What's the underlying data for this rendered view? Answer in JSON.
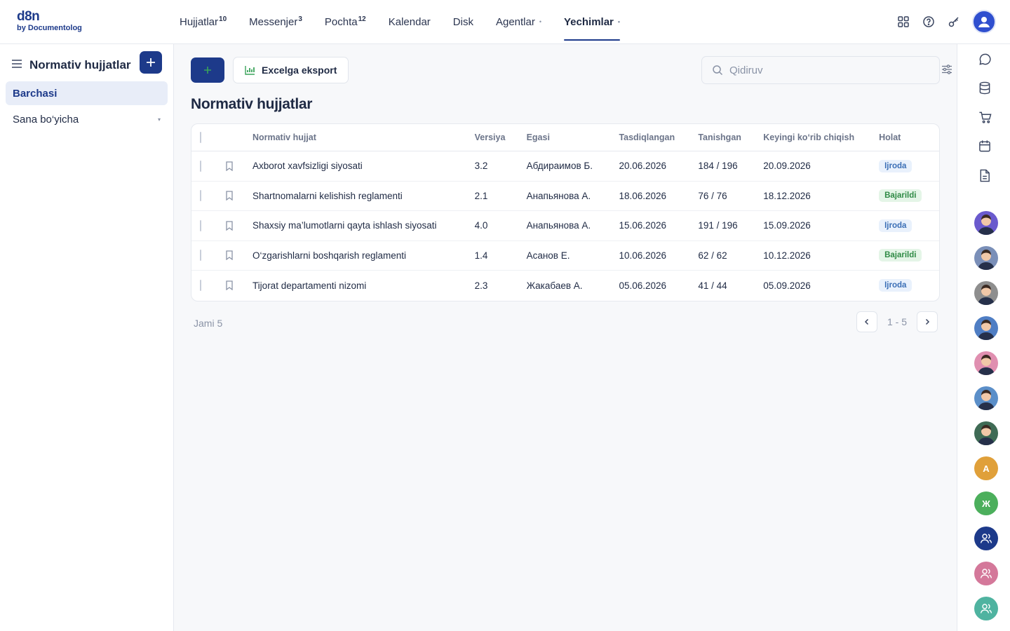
{
  "brand": {
    "line1": "d8n",
    "line2": "by Documentolog"
  },
  "nav": [
    {
      "label": "Hujjatlar",
      "badge": "10"
    },
    {
      "label": "Messenjer",
      "badge": "3"
    },
    {
      "label": "Pochta",
      "badge": "12"
    },
    {
      "label": "Kalendar"
    },
    {
      "label": "Disk"
    },
    {
      "label": "Agentlar",
      "dot": "•"
    },
    {
      "label": "Yechimlar",
      "dot": "•",
      "active": true
    }
  ],
  "top_icons": [
    "apps-grid-icon",
    "help-circle-icon",
    "key-icon",
    "user-avatar-icon"
  ],
  "sidebar": {
    "title": "Normativ hujjatlar",
    "items": [
      {
        "label": "Barchasi",
        "active": true
      },
      {
        "label": "Sana bo‘yicha",
        "caret": "▾"
      }
    ]
  },
  "toolbar": {
    "export_label": "Excelga eksport",
    "search_placeholder": "Qidiruv"
  },
  "page_title": "Normativ hujjatlar",
  "table": {
    "columns": [
      "Normativ hujjat",
      "Versiya",
      "Egasi",
      "Tasdiqlangan",
      "Tanishgan",
      "Keyingi ko‘rib chiqish",
      "Holat"
    ],
    "rows": [
      {
        "name": "Axborot xavfsizligi siyosati",
        "version": "3.2",
        "owner": "Абдираимов Б.",
        "approved": "20.06.2026",
        "acknowledged": "184 / 196",
        "next_review": "20.09.2026",
        "status": "Ijroda",
        "status_color": "blue"
      },
      {
        "name": "Shartnomalarni kelishish reglamenti",
        "version": "2.1",
        "owner": "Анапьянова А.",
        "approved": "18.06.2026",
        "acknowledged": "76 / 76",
        "next_review": "18.12.2026",
        "status": "Bajarildi",
        "status_color": "green"
      },
      {
        "name": "Shaxsiy ma’lumotlarni qayta ishlash siyosati",
        "version": "4.0",
        "owner": "Анапьянова А.",
        "approved": "15.06.2026",
        "acknowledged": "191 / 196",
        "next_review": "15.09.2026",
        "status": "Ijroda",
        "status_color": "blue"
      },
      {
        "name": "O‘zgarishlarni boshqarish reglamenti",
        "version": "1.4",
        "owner": "Асанов Е.",
        "approved": "10.06.2026",
        "acknowledged": "62 / 62",
        "next_review": "10.12.2026",
        "status": "Bajarildi",
        "status_color": "green"
      },
      {
        "name": "Tijorat departamenti nizomi",
        "version": "2.3",
        "owner": "Жакабаев А.",
        "approved": "05.06.2026",
        "acknowledged": "41 / 44",
        "next_review": "05.09.2026",
        "status": "Ijroda",
        "status_color": "blue"
      }
    ]
  },
  "footer": {
    "total": "Jami 5",
    "range": "1 - 5"
  },
  "rail": {
    "icons": [
      "chat-icon",
      "database-icon",
      "cart-icon",
      "calendar-icon",
      "document-icon"
    ],
    "avatars": [
      {
        "kind": "photo",
        "color": "#6a5acd"
      },
      {
        "kind": "photo",
        "color": "#7a8fb8"
      },
      {
        "kind": "photo",
        "color": "#8e8e8e"
      },
      {
        "kind": "photo",
        "color": "#4f7ec4"
      },
      {
        "kind": "photo",
        "color": "#e08fb0"
      },
      {
        "kind": "photo",
        "color": "#5b8fc9"
      },
      {
        "kind": "photo",
        "color": "#3f6b55"
      },
      {
        "kind": "letter",
        "letter": "A",
        "color": "#e0a03a"
      },
      {
        "kind": "letter",
        "letter": "Ж",
        "color": "#4caf5c"
      },
      {
        "kind": "user",
        "color": "#1d3a8a"
      },
      {
        "kind": "user",
        "color": "#d4789a"
      },
      {
        "kind": "user",
        "color": "#4fb3a0"
      }
    ]
  },
  "colors": {
    "primary": "#1d3a8a",
    "badge_blue": "#3b6fb6",
    "badge_green": "#2f8a45"
  }
}
